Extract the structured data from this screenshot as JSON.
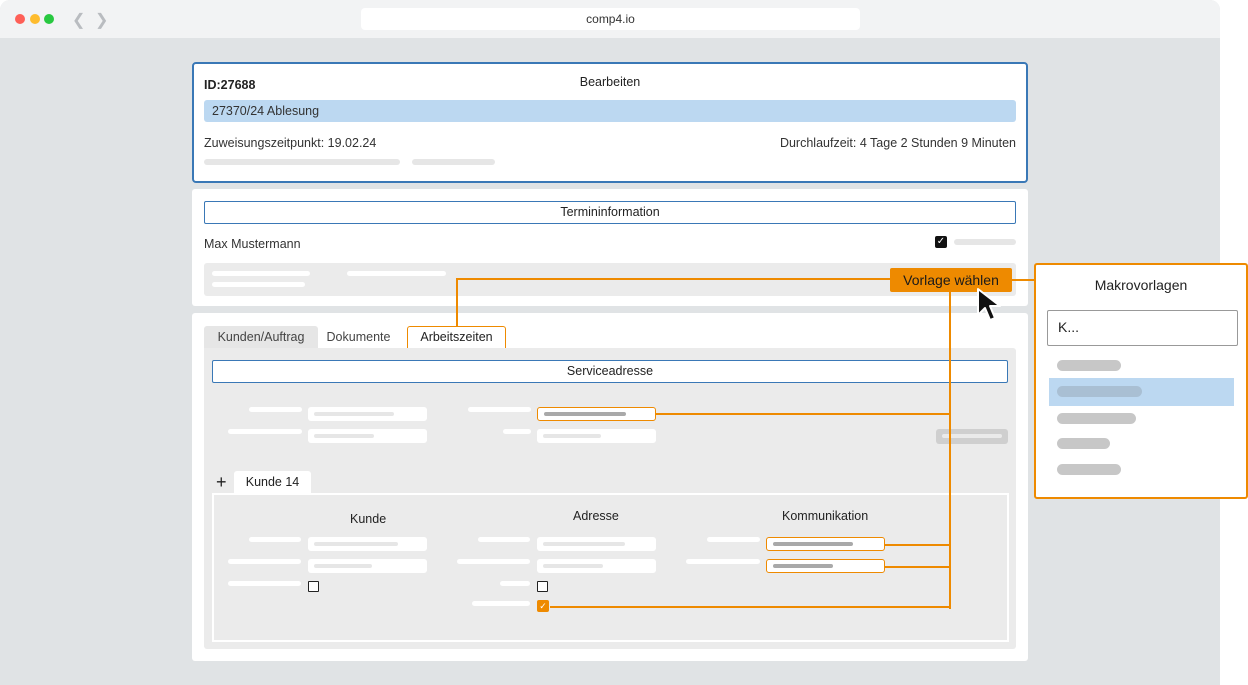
{
  "browser": {
    "url": "comp4.io",
    "back_icon": "chevron-left",
    "forward_icon": "chevron-right"
  },
  "header_card": {
    "id": "ID:27688",
    "title": "Bearbeiten",
    "highlight": "27370/24 Ablesung",
    "assignment": "Zuweisungszeitpunkt: 19.02.24",
    "duration": "Durchlaufzeit: 4 Tage 2 Stunden 9 Minuten"
  },
  "appointment": {
    "section_title": "Termininformation",
    "person": "Max Mustermann",
    "checkbox_checked": true,
    "template_button": "Vorlage wählen"
  },
  "tabs": {
    "items": [
      "Kunden/Auftrag",
      "Dokumente",
      "Arbeitszeiten"
    ],
    "active": "Arbeitszeiten"
  },
  "service": {
    "section_title": "Serviceadresse"
  },
  "customer": {
    "add_icon": "plus",
    "tab": "Kunde 14",
    "columns": [
      "Kunde",
      "Adresse",
      "Kommunikation"
    ]
  },
  "macros": {
    "title": "Makrovorlagen",
    "search_value": "K...",
    "selected_index": 1
  },
  "colors": {
    "accent": "#ee8a00",
    "blue": "#3a78b6",
    "highlight": "#bcd8f1"
  }
}
